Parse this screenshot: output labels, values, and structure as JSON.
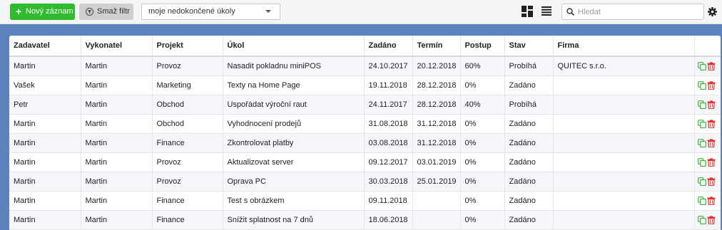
{
  "toolbar": {
    "new_record_label": "Nový záznam",
    "clear_filter_label": "Smaž filtr",
    "filter_select_value": "moje nedokončené úkoly",
    "search_placeholder": "Hledat",
    "new_record_color": "#2fba2f",
    "icons": [
      "plus-icon",
      "filter-icon",
      "chevron-down-icon",
      "grid-view-icon",
      "list-view-icon",
      "search-icon",
      "gear-icon"
    ]
  },
  "table": {
    "columns": [
      "Zadavatel",
      "Vykonatel",
      "Projekt",
      "Úkol",
      "Zadáno",
      "Termín",
      "Postup",
      "Stav",
      "Firma"
    ],
    "rows": [
      [
        "Martin",
        "Martin",
        "Provoz",
        "Nasadit pokladnu miniPOS",
        "24.10.2017",
        "20.12.2018",
        "60%",
        "Probíhá",
        "QUITEC s.r.o."
      ],
      [
        "Vašek",
        "Martin",
        "Marketing",
        "Texty na Home Page",
        "19.11.2018",
        "28.12.2018",
        "0%",
        "Zadáno",
        ""
      ],
      [
        "Petr",
        "Martin",
        "Obchod",
        "Uspořádat výroční raut",
        "24.11.2017",
        "28.12.2018",
        "40%",
        "Probíhá",
        ""
      ],
      [
        "Martin",
        "Martin",
        "Obchod",
        "Vyhodnocení prodejů",
        "31.08.2018",
        "31.12.2018",
        "0%",
        "Zadáno",
        ""
      ],
      [
        "Martin",
        "Martin",
        "Finance",
        "Zkontrolovat platby",
        "03.08.2018",
        "31.12.2018",
        "0%",
        "Zadáno",
        ""
      ],
      [
        "Martin",
        "Martin",
        "Provoz",
        "Aktualizovat server",
        "09.12.2017",
        "03.01.2019",
        "0%",
        "Zadáno",
        ""
      ],
      [
        "Martin",
        "Martin",
        "Provoz",
        "Oprava PC",
        "30.03.2018",
        "25.01.2019",
        "0%",
        "Zadáno",
        ""
      ],
      [
        "Martin",
        "Martin",
        "Finance",
        "Test s obrázkem",
        "09.11.2018",
        "",
        "0%",
        "Zadáno",
        ""
      ],
      [
        "Martin",
        "Martin",
        "Finance",
        "Snížit splatnost na 7 dnů",
        "18.06.2018",
        "",
        "0%",
        "Zadáno",
        ""
      ]
    ],
    "row_action_icons": [
      "copy-icon",
      "trash-icon"
    ],
    "copy_icon_color": "#3cb43c",
    "trash_icon_color": "#e03030"
  },
  "background_color": "#5b82bd"
}
